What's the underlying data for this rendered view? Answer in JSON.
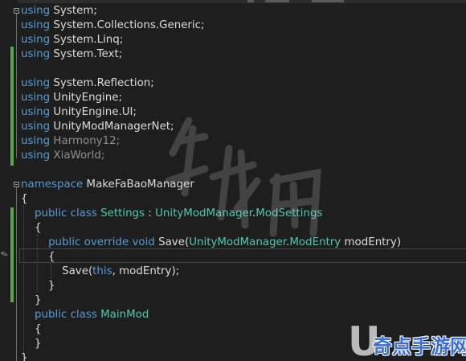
{
  "code": {
    "lines": [
      {
        "text": "using System;",
        "tokens": [
          {
            "t": "using",
            "c": "kw"
          },
          {
            "t": " System;",
            "c": "tx"
          }
        ]
      },
      {
        "text": "using System.Collections.Generic;",
        "tokens": [
          {
            "t": "using",
            "c": "kw"
          },
          {
            "t": " System.Collections.Generic;",
            "c": "tx"
          }
        ]
      },
      {
        "text": "using System.Linq;",
        "tokens": [
          {
            "t": "using",
            "c": "kw"
          },
          {
            "t": " System.Linq;",
            "c": "tx"
          }
        ]
      },
      {
        "text": "using System.Text;",
        "tokens": [
          {
            "t": "using",
            "c": "kw"
          },
          {
            "t": " System.Text;",
            "c": "tx"
          }
        ]
      },
      {
        "text": "",
        "tokens": []
      },
      {
        "text": "using System.Reflection;",
        "tokens": [
          {
            "t": "using",
            "c": "kw"
          },
          {
            "t": " System.Reflection;",
            "c": "tx"
          }
        ]
      },
      {
        "text": "using UnityEngine;",
        "tokens": [
          {
            "t": "using",
            "c": "kw"
          },
          {
            "t": " UnityEngine;",
            "c": "tx"
          }
        ]
      },
      {
        "text": "using UnityEngine.UI;",
        "tokens": [
          {
            "t": "using",
            "c": "kw"
          },
          {
            "t": " UnityEngine.UI;",
            "c": "tx"
          }
        ]
      },
      {
        "text": "using UnityModManagerNet;",
        "tokens": [
          {
            "t": "using",
            "c": "kw"
          },
          {
            "t": " UnityModManagerNet;",
            "c": "tx"
          }
        ]
      },
      {
        "text": "using Harmony12;",
        "tokens": [
          {
            "t": "using",
            "c": "kw"
          },
          {
            "t": " Harmony12;",
            "c": "dim"
          }
        ]
      },
      {
        "text": "using XiaWorld;",
        "tokens": [
          {
            "t": "using",
            "c": "kw"
          },
          {
            "t": " XiaWorld;",
            "c": "dim"
          }
        ]
      },
      {
        "text": "",
        "tokens": []
      },
      {
        "text": "namespace MakeFaBaoManager",
        "tokens": [
          {
            "t": "namespace",
            "c": "kw"
          },
          {
            "t": " MakeFaBaoManager",
            "c": "tx"
          }
        ]
      },
      {
        "text": "{",
        "tokens": [
          {
            "t": "{",
            "c": "tx"
          }
        ]
      },
      {
        "text": "    public class Settings : UnityModManager.ModSettings",
        "tokens": [
          {
            "t": "    ",
            "c": "tx"
          },
          {
            "t": "public",
            "c": "kw"
          },
          {
            "t": " ",
            "c": "tx"
          },
          {
            "t": "class",
            "c": "kw"
          },
          {
            "t": " ",
            "c": "tx"
          },
          {
            "t": "Settings",
            "c": "ty"
          },
          {
            "t": " : ",
            "c": "tx"
          },
          {
            "t": "UnityModManager",
            "c": "ty"
          },
          {
            "t": ".",
            "c": "tx"
          },
          {
            "t": "ModSettings",
            "c": "ty"
          }
        ]
      },
      {
        "text": "    {",
        "tokens": [
          {
            "t": "    {",
            "c": "tx"
          }
        ]
      },
      {
        "text": "        public override void Save(UnityModManager.ModEntry modEntry)",
        "tokens": [
          {
            "t": "        ",
            "c": "tx"
          },
          {
            "t": "public",
            "c": "kw"
          },
          {
            "t": " ",
            "c": "tx"
          },
          {
            "t": "override",
            "c": "kw"
          },
          {
            "t": " ",
            "c": "tx"
          },
          {
            "t": "void",
            "c": "kw"
          },
          {
            "t": " Save(",
            "c": "tx"
          },
          {
            "t": "UnityModManager",
            "c": "ty"
          },
          {
            "t": ".",
            "c": "tx"
          },
          {
            "t": "ModEntry",
            "c": "ty"
          },
          {
            "t": " modEntry)",
            "c": "tx"
          }
        ]
      },
      {
        "text": "        {",
        "tokens": [
          {
            "t": "        {",
            "c": "tx"
          }
        ]
      },
      {
        "text": "            Save(this, modEntry);",
        "tokens": [
          {
            "t": "            Save(",
            "c": "tx"
          },
          {
            "t": "this",
            "c": "kw"
          },
          {
            "t": ", modEntry);",
            "c": "tx"
          }
        ]
      },
      {
        "text": "        }",
        "tokens": [
          {
            "t": "        }",
            "c": "tx"
          }
        ]
      },
      {
        "text": "    }",
        "tokens": [
          {
            "t": "    }",
            "c": "tx"
          }
        ]
      },
      {
        "text": "    public class MainMod",
        "tokens": [
          {
            "t": "    ",
            "c": "tx"
          },
          {
            "t": "public",
            "c": "kw"
          },
          {
            "t": " ",
            "c": "tx"
          },
          {
            "t": "class",
            "c": "kw"
          },
          {
            "t": " ",
            "c": "tx"
          },
          {
            "t": "MainMod",
            "c": "ty"
          }
        ]
      },
      {
        "text": "    {",
        "tokens": [
          {
            "t": "    {",
            "c": "tx"
          }
        ]
      },
      {
        "text": "    }",
        "tokens": [
          {
            "t": "    }",
            "c": "tx"
          }
        ]
      },
      {
        "text": "}",
        "tokens": [
          {
            "t": "}",
            "c": "tx"
          }
        ]
      }
    ]
  },
  "watermark": {
    "corner_letter": "U",
    "corner_text": "奇点手游网",
    "center_text": "游侠网"
  },
  "colors": {
    "background": "#1e1e1e",
    "keyword": "#569cd6",
    "type": "#4ec9b0",
    "text": "#dcdcdc",
    "unused_namespace": "#8f8f8f",
    "change_bar": "#57a64a"
  },
  "icons": {
    "gutter_edit": "pencil-icon",
    "fold": "collapse-region-icon"
  }
}
